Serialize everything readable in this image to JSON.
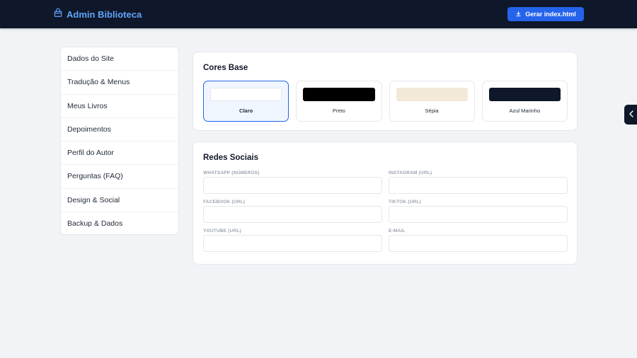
{
  "header": {
    "title": "Admin Biblioteca",
    "brand_icon": "book-bag-icon",
    "generate_label": "Gerar index.html",
    "generate_icon": "download-icon",
    "accent_color": "#60a5fa",
    "bg_color": "#0f172a"
  },
  "sidebar": {
    "items": [
      {
        "label": "Dados do Site"
      },
      {
        "label": "Tradução & Menus"
      },
      {
        "label": "Meus Livros"
      },
      {
        "label": "Depoimentos"
      },
      {
        "label": "Perfil do Autor"
      },
      {
        "label": "Perguntas (FAQ)"
      },
      {
        "label": "Design & Social"
      },
      {
        "label": "Backup & Dados"
      }
    ]
  },
  "cores": {
    "title": "Cores Base",
    "selected": "Claro",
    "themes": [
      {
        "label": "Claro",
        "color": "#ffffff"
      },
      {
        "label": "Preto",
        "color": "#000000"
      },
      {
        "label": "Sépia",
        "color": "#f3e9d8"
      },
      {
        "label": "Azul Marinho",
        "color": "#0f172a"
      }
    ]
  },
  "redes": {
    "title": "Redes Sociais",
    "fields": [
      {
        "label": "WHATSAPP (NÚMEROS)",
        "value": "",
        "placeholder": ""
      },
      {
        "label": "INSTAGRAM (URL)",
        "value": "",
        "placeholder": ""
      },
      {
        "label": "FACEBOOK (URL)",
        "value": "",
        "placeholder": ""
      },
      {
        "label": "TIKTOK (URL)",
        "value": "",
        "placeholder": ""
      },
      {
        "label": "YOUTUBE (URL)",
        "value": "",
        "placeholder": ""
      },
      {
        "label": "E-MAIL",
        "value": "",
        "placeholder": ""
      }
    ]
  },
  "side_tab": {
    "icon": "chevron-left-icon"
  }
}
